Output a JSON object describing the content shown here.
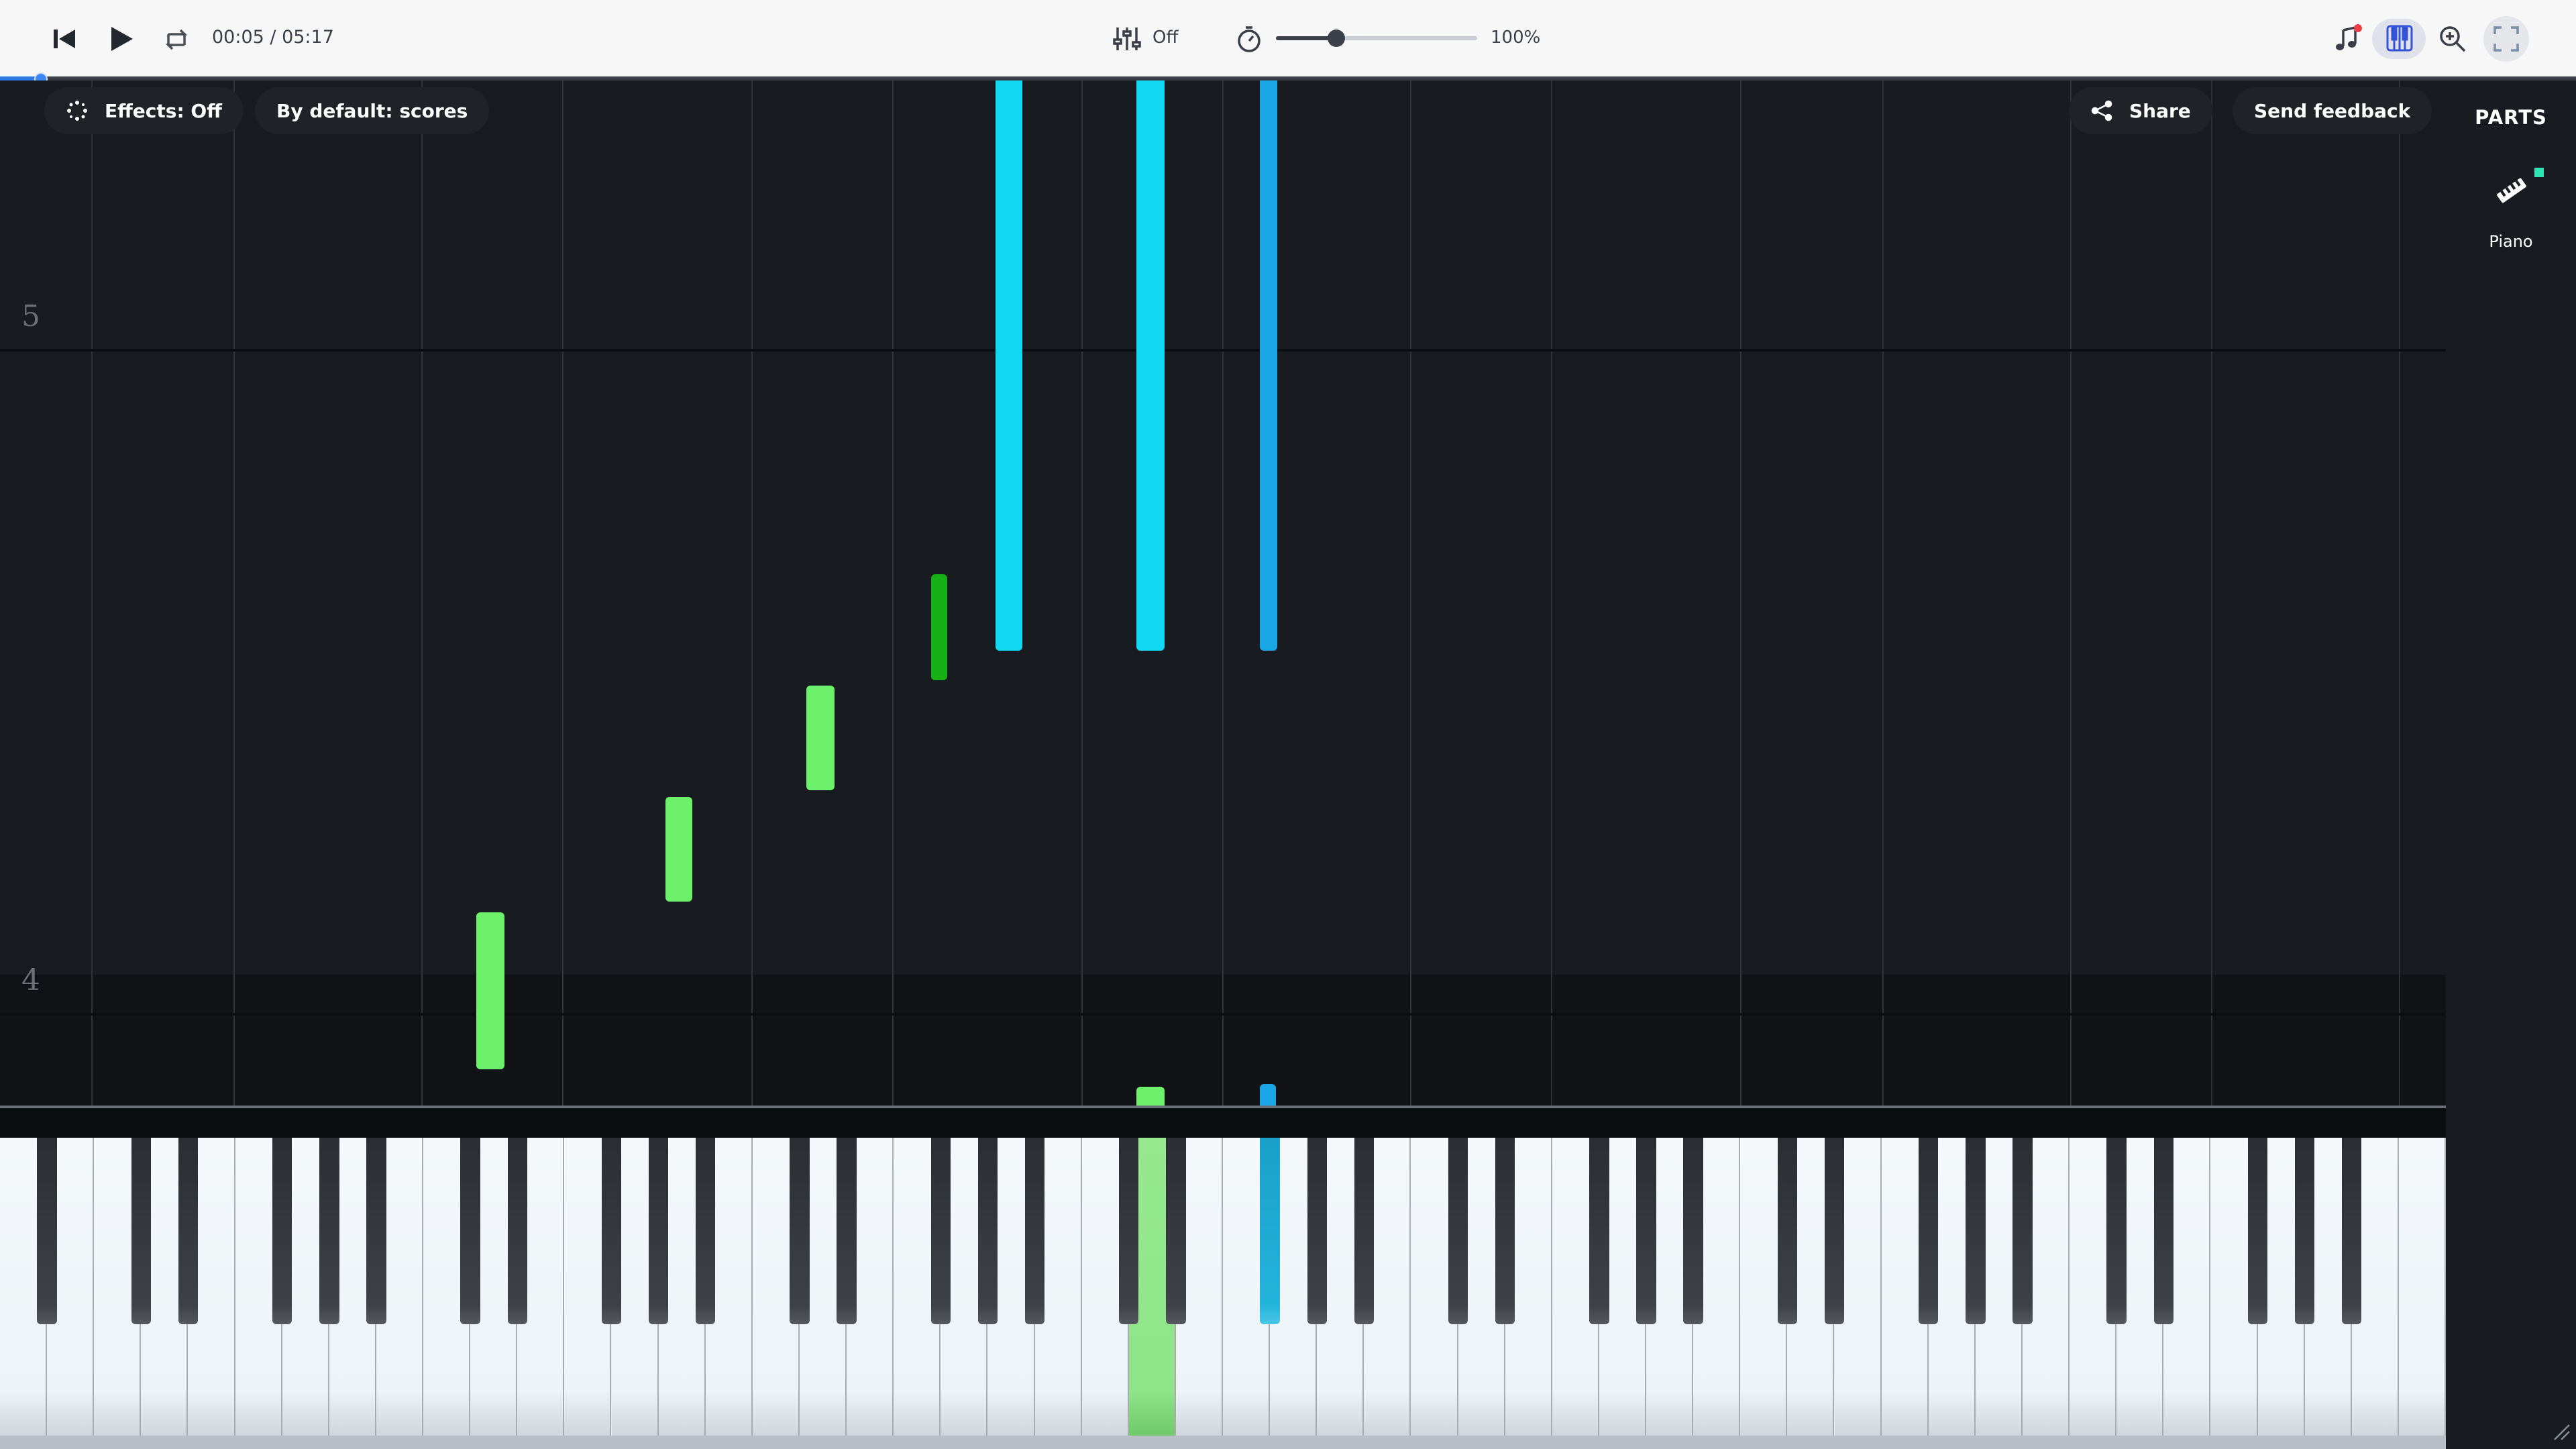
{
  "toolbar": {
    "time": "00:05 / 05:17",
    "metronome_label": "Off",
    "volume_percent": "100%",
    "volume_level": 0.3,
    "icons": {
      "rewind": "skip-back-icon",
      "play": "play-icon",
      "loop": "loop-icon",
      "mixer": "mixer-sliders-icon",
      "speed": "stopwatch-icon",
      "notation": "music-note-icon",
      "piano_roll": "piano-roll-icon",
      "zoom": "zoom-in-icon",
      "fullscreen": "fullscreen-icon"
    }
  },
  "progress": {
    "fraction": 0.016
  },
  "overlay": {
    "effects_label": "Effects: Off",
    "default_label": "By default: scores",
    "share_label": "Share",
    "feedback_label": "Send feedback"
  },
  "roll": {
    "octave_labels": [
      "5",
      "4"
    ]
  },
  "parts": {
    "title": "PARTS",
    "items": [
      {
        "label": "Piano",
        "icon": "piano-icon"
      }
    ]
  },
  "colors": {
    "green_note": "#6df06a",
    "dark_green_note": "#18b018",
    "cyan_note": "#10d8f2",
    "blue_note": "#1aa6e6",
    "accent_blue": "#2f7be6",
    "part_marker": "#2ee6b4"
  }
}
